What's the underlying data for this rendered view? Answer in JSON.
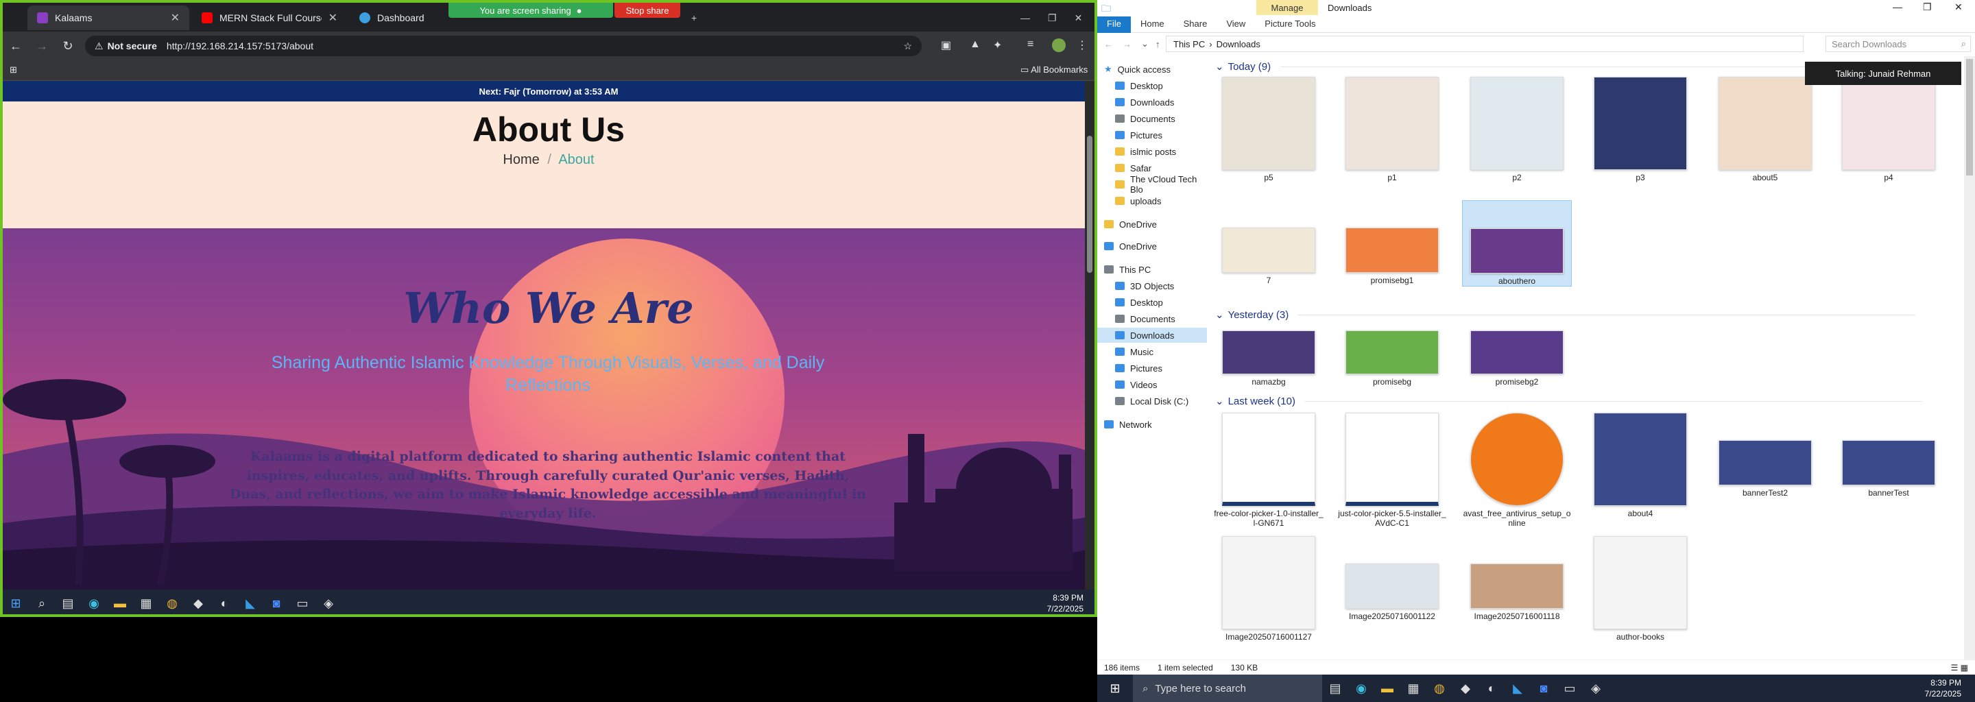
{
  "browser": {
    "tabs": [
      {
        "title": "Kalaams",
        "color": "#8a3fc3"
      },
      {
        "title": "MERN Stack Full Course - ECom",
        "color": "#ff0000"
      },
      {
        "title": "Dashboard",
        "color": "#3b9fe0"
      }
    ],
    "share_text": "You are screen sharing",
    "stop_share": "Stop share",
    "not_secure": "Not secure",
    "url": "http://192.168.214.157:5173/about",
    "all_bookmarks": "All Bookmarks"
  },
  "site": {
    "prayer_banner": "Next: Fajr (Tomorrow) at 3:53 AM",
    "page_title": "About Us",
    "breadcrumb_home": "Home",
    "breadcrumb_sep": "/",
    "breadcrumb_current": "About",
    "hero_heading": "Who We Are",
    "tagline": "Sharing Authentic Islamic Knowledge Through Visuals, Verses, and Daily Reflections",
    "description": "Kalaams is a digital platform dedicated to sharing authentic Islamic content that inspires, educates, and uplifts. Through carefully curated Qur'anic verses, Hadith, Duas, and reflections, we aim to make Islamic knowledge accessible and meaningful in everyday life."
  },
  "left_taskbar": {
    "time": "8:39 PM",
    "date": "7/22/2025"
  },
  "explorer": {
    "window_title": "Downloads",
    "manage_label": "Manage",
    "ribbon_tabs": [
      "File",
      "Home",
      "Share",
      "View",
      "Picture Tools"
    ],
    "path": [
      "This PC",
      "Downloads"
    ],
    "search_placeholder": "Search Downloads",
    "nav": [
      {
        "label": "Quick access",
        "kind": "star"
      },
      {
        "label": "Desktop",
        "kind": "blue"
      },
      {
        "label": "Downloads",
        "kind": "blue"
      },
      {
        "label": "Documents",
        "kind": "gray"
      },
      {
        "label": "Pictures",
        "kind": "blue"
      },
      {
        "label": "islmic posts",
        "kind": "folder"
      },
      {
        "label": "Safar",
        "kind": "folder"
      },
      {
        "label": "The vCloud Tech Blo",
        "kind": "folder"
      },
      {
        "label": "uploads",
        "kind": "folder"
      },
      {
        "label": "OneDrive",
        "kind": "folder"
      },
      {
        "label": "OneDrive",
        "kind": "blue"
      },
      {
        "label": "This PC",
        "kind": "gray"
      },
      {
        "label": "3D Objects",
        "kind": "blue"
      },
      {
        "label": "Desktop",
        "kind": "blue"
      },
      {
        "label": "Documents",
        "kind": "gray"
      },
      {
        "label": "Downloads",
        "kind": "blue"
      },
      {
        "label": "Music",
        "kind": "blue"
      },
      {
        "label": "Pictures",
        "kind": "blue"
      },
      {
        "label": "Videos",
        "kind": "blue"
      },
      {
        "label": "Local Disk (C:)",
        "kind": "gray"
      },
      {
        "label": "Network",
        "kind": "blue"
      }
    ],
    "groups": [
      {
        "label": "Today (9)",
        "items": [
          "p5",
          "p1",
          "p2",
          "p3",
          "about5",
          "p4",
          "7",
          "promisebg1",
          "abouthero"
        ]
      },
      {
        "label": "Yesterday (3)",
        "items": [
          "namazbg",
          "promisebg",
          "promisebg2"
        ]
      },
      {
        "label": "Last week (10)",
        "items": [
          "free-color-picker-1.0-installer_l-GN671",
          "just-color-picker-5.5-installer_AVdC-C1",
          "avast_free_antivirus_setup_online",
          "about4",
          "bannerTest2",
          "bannerTest",
          "Image20250716001127",
          "Image20250716001122",
          "Image20250716001118",
          "author-books"
        ]
      }
    ],
    "selected_item": "abouthero",
    "status_count": "186 items",
    "status_selected": "1 item selected",
    "status_size": "130 KB",
    "tooltip": "Talking: Junaid Rehman"
  },
  "windows_taskbar": {
    "search_placeholder": "Type here to search",
    "time": "8:39 PM",
    "date": "7/22/2025"
  }
}
